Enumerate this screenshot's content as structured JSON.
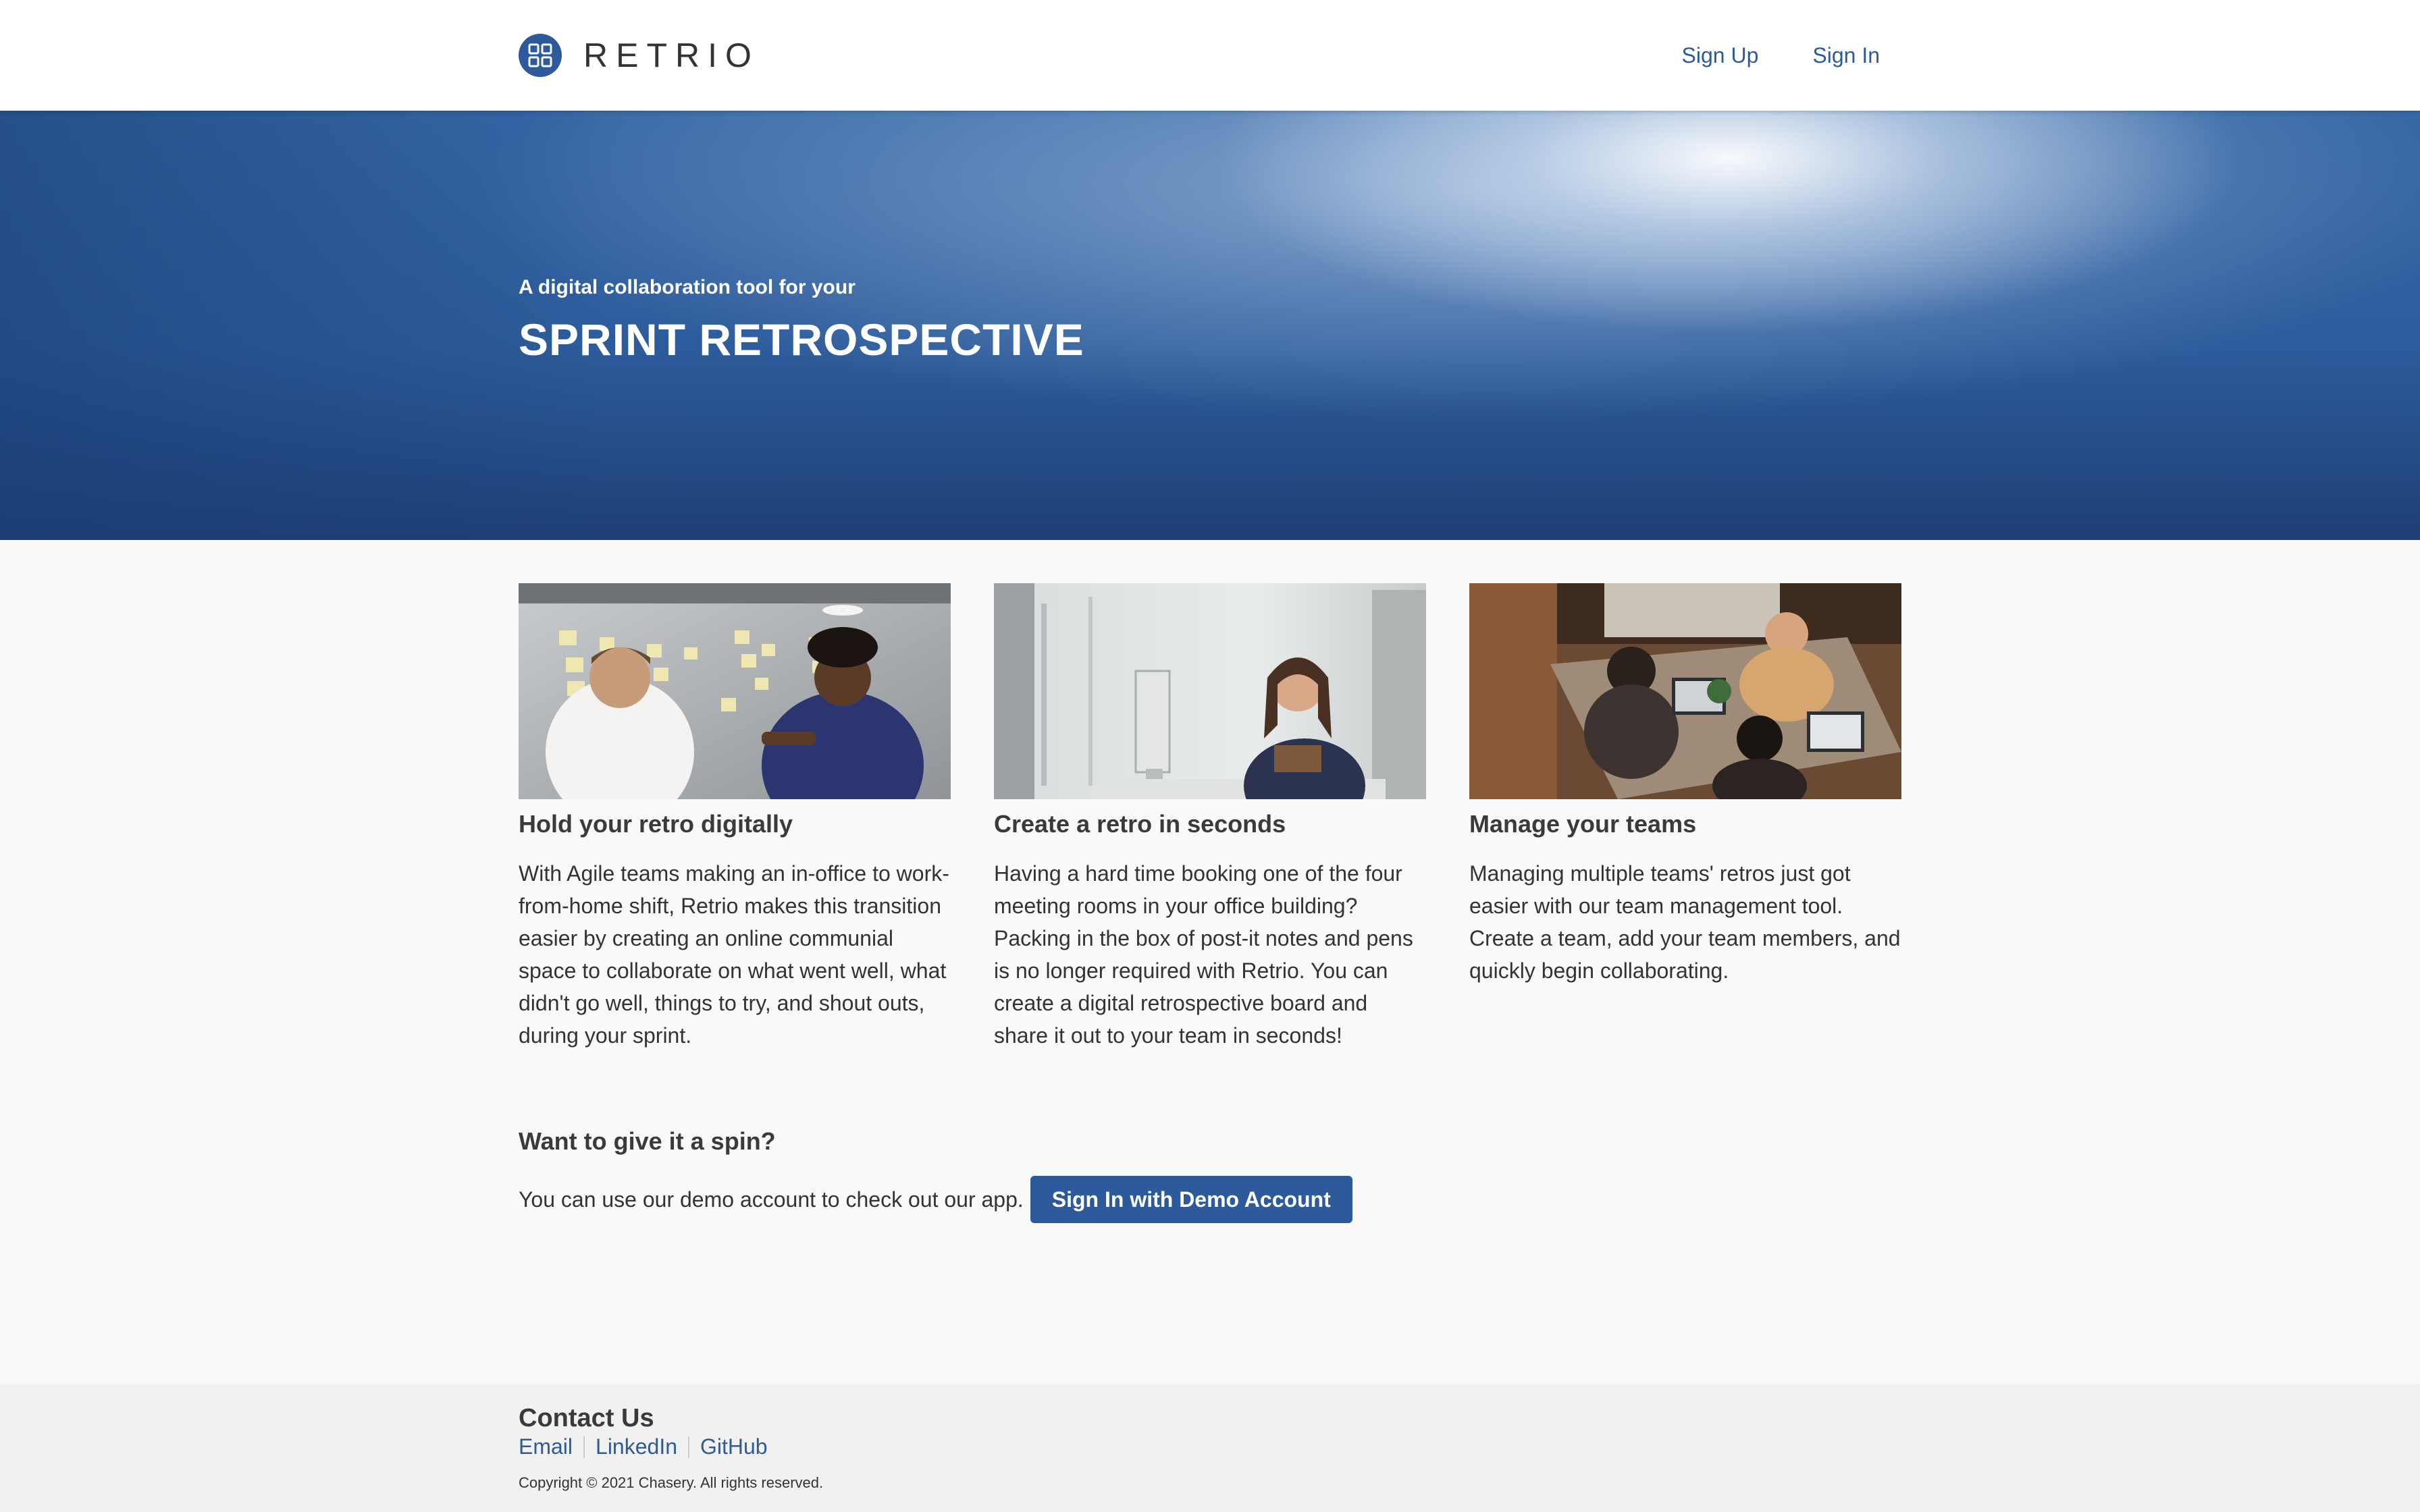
{
  "header": {
    "brand": "RETRIO",
    "nav": {
      "sign_up": "Sign Up",
      "sign_in": "Sign In"
    }
  },
  "hero": {
    "subtitle": "A digital collaboration tool for your",
    "title": "SPRINT RETROSPECTIVE"
  },
  "features": [
    {
      "title": "Hold your retro digitally",
      "text": "With Agile teams making an in-office to work-from-home shift, Retrio makes this transition easier by creating an online communial space to collaborate on what went well, what didn't go well, things to try, and shout outs, during your sprint."
    },
    {
      "title": "Create a retro in seconds",
      "text": "Having a hard time booking one of the four meeting rooms in your office building? Packing in the box of post-it notes and pens is no longer required with Retrio. You can create a digital retrospective board and share it out to your team in seconds!"
    },
    {
      "title": "Manage your teams",
      "text": "Managing multiple teams' retros just got easier with our team management tool. Create a team, add your team members, and quickly begin collaborating."
    }
  ],
  "demo": {
    "title": "Want to give it a spin?",
    "text": "You can use our demo account to check out our app.",
    "button": "Sign In with Demo Account"
  },
  "footer": {
    "contact_title": "Contact Us",
    "links": {
      "email": "Email",
      "linkedin": "LinkedIn",
      "github": "GitHub"
    },
    "copyright": "Copyright © 2021 Chasery. All rights reserved."
  },
  "colors": {
    "accent": "#2d5a9b",
    "hero_dark": "#1e3f75",
    "background": "#f9f9f9",
    "footer_bg": "#f1f1f1"
  }
}
